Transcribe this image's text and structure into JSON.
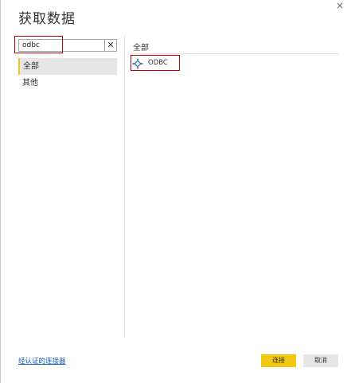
{
  "dialog": {
    "title": "获取数据",
    "close_glyph": "×"
  },
  "search": {
    "value": "odbc",
    "clear_glyph": "✕"
  },
  "categories": [
    {
      "label": "全部",
      "selected": true
    },
    {
      "label": "其他",
      "selected": false
    }
  ],
  "results": {
    "header": "全部",
    "items": [
      {
        "label": "ODBC",
        "icon": "odbc-connector-icon"
      }
    ]
  },
  "footer": {
    "certified_link": "经认证的连接器",
    "connect_label": "连接",
    "cancel_label": "取消"
  },
  "colors": {
    "accent": "#f2c811",
    "highlight_box": "#c00000",
    "link": "#1a5fb4"
  }
}
